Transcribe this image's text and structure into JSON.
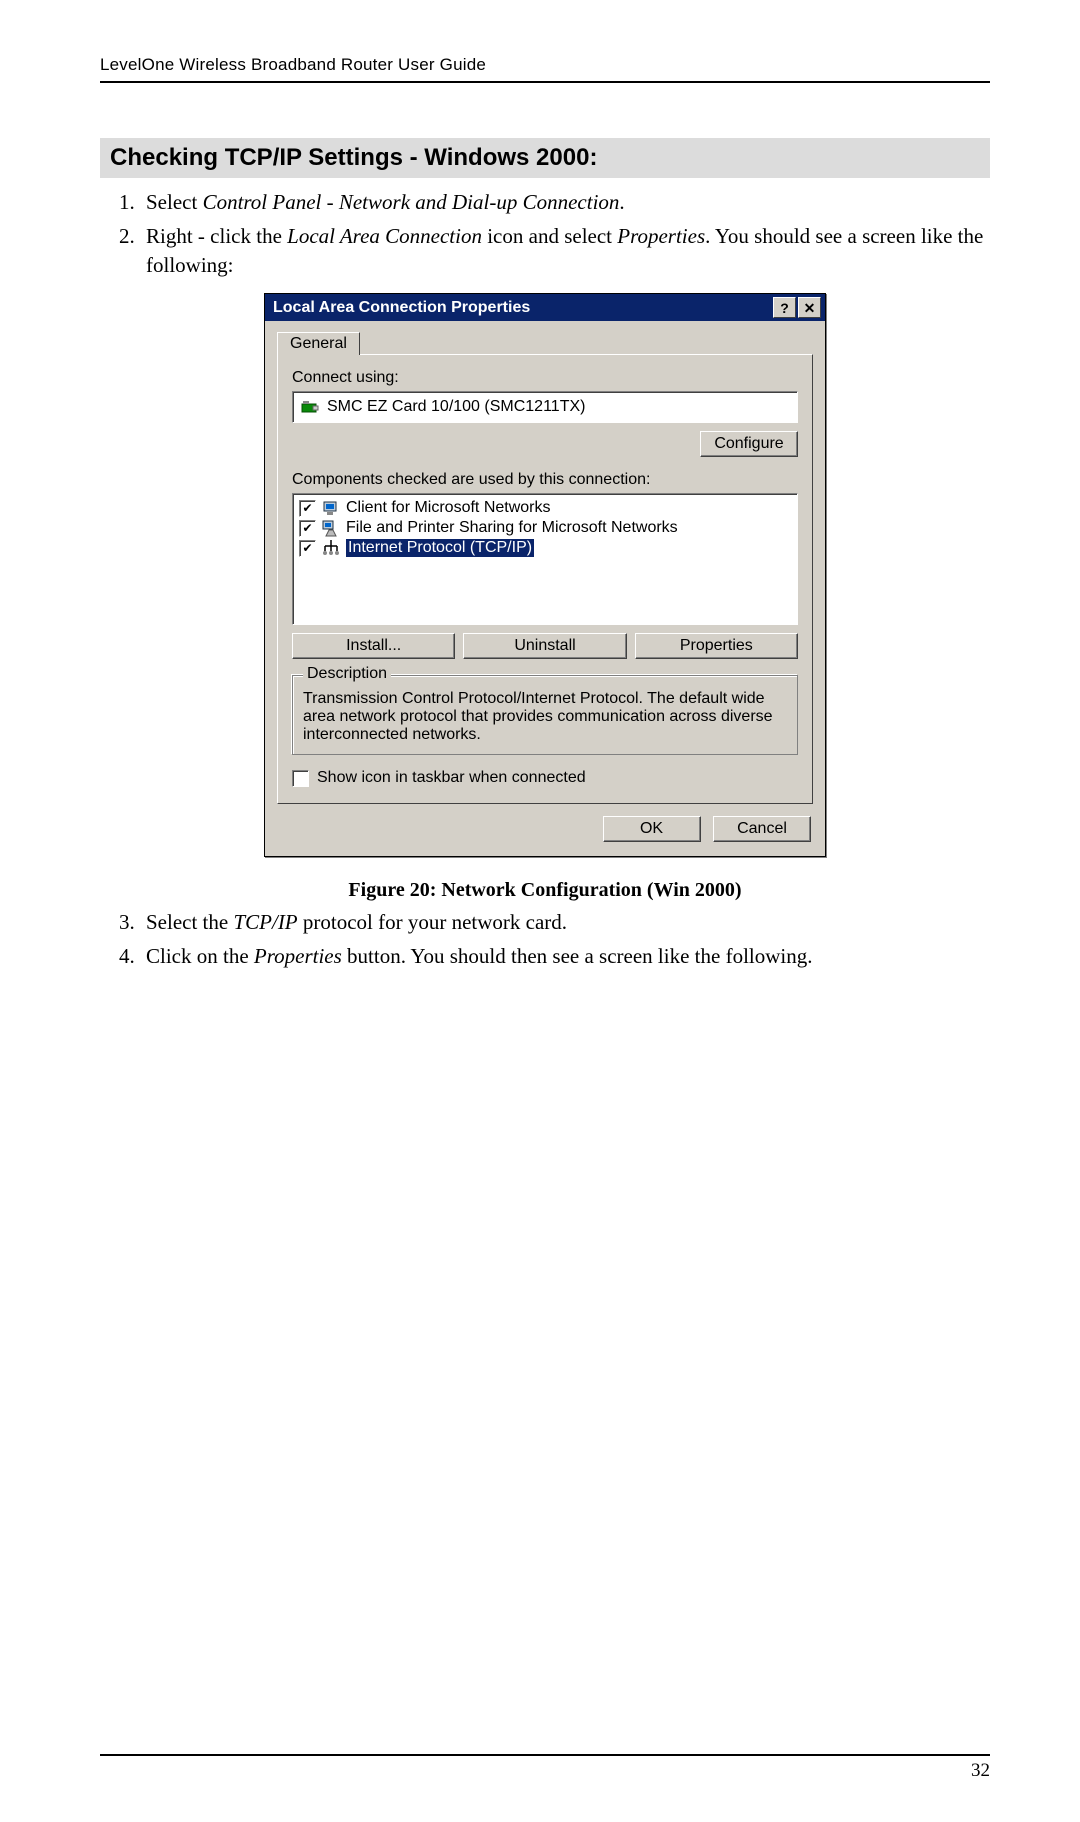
{
  "header": "LevelOne Wireless Broadband Router User Guide",
  "section_title": "Checking TCP/IP Settings - Windows 2000:",
  "steps_before": [
    {
      "prefix": "Select ",
      "italic": "Control Panel - Network and Dial-up Connection",
      "suffix": "."
    },
    {
      "prefix": "Right - click the ",
      "italic": "Local Area Connection",
      "mid": " icon and select ",
      "italic2": "Properties",
      "suffix": ". You should see a screen like the following:"
    }
  ],
  "dialog": {
    "title": "Local Area Connection Properties",
    "tab": "General",
    "connect_using_label": "Connect using:",
    "adapter": "SMC EZ Card 10/100 (SMC1211TX)",
    "configure": "Configure",
    "components_label": "Components checked are used by this connection:",
    "components": [
      {
        "label": "Client for Microsoft Networks",
        "selected": false
      },
      {
        "label": "File and Printer Sharing for Microsoft Networks",
        "selected": false
      },
      {
        "label": "Internet Protocol (TCP/IP)",
        "selected": true
      }
    ],
    "install": "Install...",
    "uninstall": "Uninstall",
    "properties": "Properties",
    "desc_label": "Description",
    "desc_text": "Transmission Control Protocol/Internet Protocol. The default wide area network protocol that provides communication across diverse interconnected networks.",
    "taskbar": "Show icon in taskbar when connected",
    "ok": "OK",
    "cancel": "Cancel"
  },
  "caption": "Figure 20: Network Configuration (Win 2000)",
  "steps_after": [
    {
      "prefix": "Select the ",
      "italic": "TCP/IP",
      "suffix": " protocol for your network card."
    },
    {
      "prefix": "Click on the ",
      "italic": "Properties",
      "suffix": " button. You should then see a screen like the following."
    }
  ],
  "page_number": "32"
}
